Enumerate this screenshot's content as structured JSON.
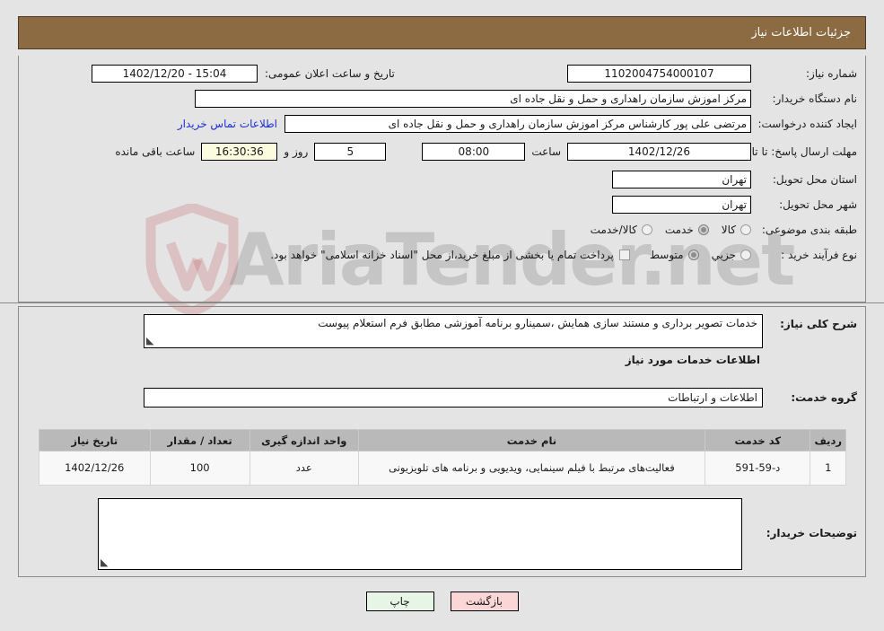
{
  "header": {
    "title": "جزئیات اطلاعات نیاز"
  },
  "form": {
    "need_number_label": "شماره نیاز:",
    "need_number_value": "1102004754000107",
    "public_announce_label": "تاریخ و ساعت اعلان عمومی:",
    "public_announce_value": "15:04 - 1402/12/20",
    "buyer_org_label": "نام دستگاه خریدار:",
    "buyer_org_value": "مرکز اموزش سازمان راهداری و حمل و نقل جاده ای",
    "creator_label": "ایجاد کننده درخواست:",
    "creator_value": "مرتضی علی پور کارشناس مرکز اموزش سازمان راهداری و حمل و نقل جاده ای",
    "contact_link": "اطلاعات تماس خریدار",
    "deadline_label": "مهلت ارسال پاسخ: تا تاریخ:",
    "deadline_date": "1402/12/26",
    "hour_label": "ساعت",
    "deadline_time": "08:00",
    "days_value": "5",
    "days_label": "روز و",
    "countdown_value": "16:30:36",
    "countdown_label": "ساعت باقی مانده",
    "province_label": "استان محل تحویل:",
    "province_value": "تهران",
    "city_label": "شهر محل تحویل:",
    "city_value": "تهران",
    "category_label": "طبقه بندی موضوعی:",
    "category_options": [
      {
        "label": "کالا",
        "selected": false
      },
      {
        "label": "خدمت",
        "selected": true
      },
      {
        "label": "کالا/خدمت",
        "selected": false
      }
    ],
    "process_label": "نوع فرآیند خرید :",
    "process_options": [
      {
        "label": "جزیي",
        "selected": false
      },
      {
        "label": "متوسط",
        "selected": true
      }
    ],
    "treasury_checkbox_text": "پرداخت تمام یا بخشی از مبلغ خرید،از محل \"اسناد خزانه اسلامی\" خواهد بود.",
    "treasury_checked": false
  },
  "description": {
    "label": "شرح کلی نیاز:",
    "value": "خدمات تصویر برداری و مستند سازی همایش ،سمینارو برنامه آموزشی مطابق فرم استعلام پیوست"
  },
  "services_section": {
    "heading": "اطلاعات خدمات مورد نیاز",
    "group_label": "گروه خدمت:",
    "group_value": "اطلاعات و ارتباطات"
  },
  "table": {
    "columns": [
      "ردیف",
      "کد خدمت",
      "نام خدمت",
      "واحد اندازه گیری",
      "تعداد / مقدار",
      "تاریخ نیاز"
    ],
    "rows": [
      {
        "radif": "1",
        "code": "د-59-591",
        "name": "فعالیت‌های مرتبط با فیلم سینمایی، ویدیویی و برنامه های تلویزیونی",
        "unit": "عدد",
        "qty": "100",
        "date": "1402/12/26"
      }
    ]
  },
  "comments": {
    "label": "توضیحات خریدار:",
    "value": ""
  },
  "buttons": {
    "print": "چاپ",
    "back": "بازگشت"
  },
  "watermark": {
    "text": "AriaTender.net"
  },
  "colors": {
    "header_bg": "#8c6b42",
    "page_bg": "#e4e4e4",
    "link": "#1c2fd4",
    "print_btn": "#e6f5e6",
    "back_btn": "#fbd6d6",
    "highlight_field": "#fbfbe0",
    "table_header": "#b9b9b9"
  }
}
